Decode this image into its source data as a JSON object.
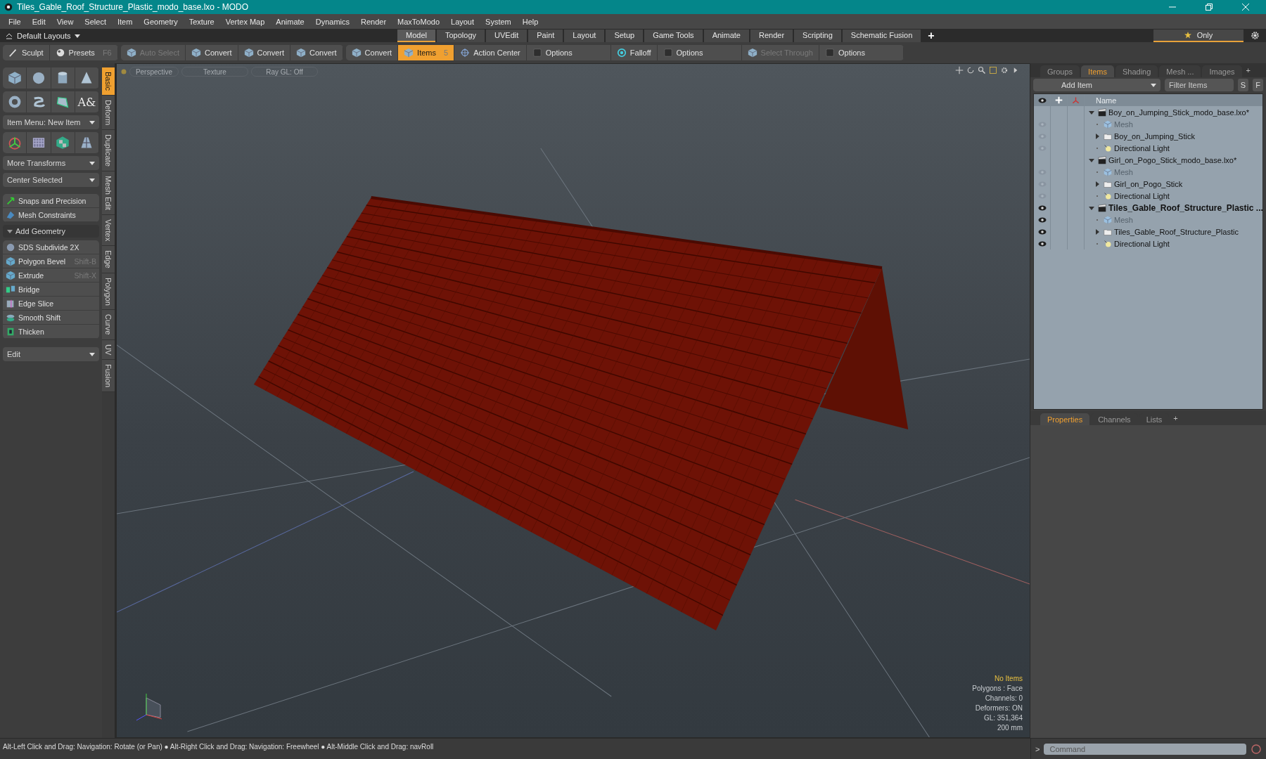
{
  "window": {
    "title": "Tiles_Gable_Roof_Structure_Plastic_modo_base.lxo - MODO"
  },
  "menu": [
    "File",
    "Edit",
    "View",
    "Select",
    "Item",
    "Geometry",
    "Texture",
    "Vertex Map",
    "Animate",
    "Dynamics",
    "Render",
    "MaxToModo",
    "Layout",
    "System",
    "Help"
  ],
  "layout_bar": {
    "layouts": "Default Layouts",
    "add": "+",
    "only": "Only",
    "tabs": [
      {
        "label": "Model",
        "selected": true
      },
      {
        "label": "Topology",
        "selected": false
      },
      {
        "label": "UVEdit",
        "selected": false
      },
      {
        "label": "Paint",
        "selected": false
      },
      {
        "label": "Layout",
        "selected": false
      },
      {
        "label": "Setup",
        "selected": false
      },
      {
        "label": "Game Tools",
        "selected": false
      },
      {
        "label": "Animate",
        "selected": false
      },
      {
        "label": "Render",
        "selected": false
      },
      {
        "label": "Scripting",
        "selected": false
      },
      {
        "label": "Schematic Fusion",
        "selected": false
      }
    ]
  },
  "toolbar": [
    [
      {
        "label": "Sculpt",
        "kind": "brush",
        "disabled": false,
        "selected": false
      },
      {
        "label": "Presets",
        "kind": "ball",
        "shortcut": "F6",
        "disabled": false,
        "selected": false
      }
    ],
    [
      {
        "label": "Auto Select",
        "kind": "cube",
        "disabled": true,
        "selected": false
      },
      {
        "label": "Convert",
        "kind": "cube",
        "disabled": false,
        "selected": false
      },
      {
        "label": "Convert",
        "kind": "cube",
        "disabled": false,
        "selected": false
      },
      {
        "label": "Convert",
        "kind": "cube",
        "disabled": false,
        "selected": false
      }
    ],
    [
      {
        "label": "Convert",
        "kind": "cube",
        "disabled": false,
        "selected": false
      },
      {
        "label": "Items",
        "kind": "cube",
        "shortcut": "5",
        "disabled": false,
        "selected": true
      },
      {
        "label": "Action Center",
        "kind": "target",
        "disabled": false,
        "selected": false
      },
      {
        "label": "Options",
        "kind": "option",
        "disabled": false,
        "selected": false
      },
      {
        "label": "Falloff",
        "kind": "ring",
        "disabled": false,
        "selected": false
      },
      {
        "label": "Options",
        "kind": "option",
        "disabled": false,
        "selected": false
      },
      {
        "label": "Select Through",
        "kind": "cube",
        "disabled": true,
        "selected": false
      },
      {
        "label": "Options",
        "kind": "option",
        "disabled": false,
        "selected": false
      }
    ]
  ],
  "left_panel": {
    "text_glyph": "A&",
    "item_menu": "Item Menu: New Item",
    "dropdowns": [
      "More Transforms",
      "Center Selected"
    ],
    "constraints": [
      {
        "label": "Snaps and Precision",
        "kind": "snap"
      },
      {
        "label": "Mesh Constraints",
        "kind": "constraint"
      }
    ],
    "section": {
      "label": "Add Geometry",
      "expanded": true
    },
    "tools": [
      {
        "label": "SDS Subdivide 2X",
        "kind": "sds"
      },
      {
        "label": "Polygon Bevel",
        "shortcut": "Shift-B",
        "kind": "cube"
      },
      {
        "label": "Extrude",
        "shortcut": "Shift-X",
        "kind": "cube"
      },
      {
        "label": "Bridge",
        "kind": "bridge"
      },
      {
        "label": "Edge Slice",
        "kind": "slice"
      },
      {
        "label": "Smooth Shift",
        "kind": "smooth"
      },
      {
        "label": "Thicken",
        "kind": "thicken"
      }
    ],
    "edit": "Edit",
    "side_tabs": [
      {
        "label": "Basic",
        "selected": true
      },
      {
        "label": "Deform",
        "selected": false
      },
      {
        "label": "Duplicate",
        "selected": false
      },
      {
        "label": "Mesh Edit",
        "selected": false
      },
      {
        "label": "Vertex",
        "selected": false
      },
      {
        "label": "Edge",
        "selected": false
      },
      {
        "label": "Polygon",
        "selected": false
      },
      {
        "label": "Curve",
        "selected": false
      },
      {
        "label": "UV",
        "selected": false
      },
      {
        "label": "Fusion",
        "selected": false
      }
    ]
  },
  "viewport": {
    "header": [
      "Perspective",
      "Texture",
      "Ray GL: Off"
    ],
    "info": [
      {
        "text": "No Items",
        "highlight": true
      },
      {
        "text": "Polygons : Face",
        "highlight": false
      },
      {
        "text": "Channels: 0",
        "highlight": false
      },
      {
        "text": "Deformers: ON",
        "highlight": false
      },
      {
        "text": "GL: 351,364",
        "highlight": false
      },
      {
        "text": "200 mm",
        "highlight": false
      }
    ]
  },
  "items_panel": {
    "tabs": [
      {
        "label": "Groups",
        "selected": false
      },
      {
        "label": "Items",
        "selected": true
      },
      {
        "label": "Shading",
        "selected": false
      },
      {
        "label": "Mesh ...",
        "selected": false
      },
      {
        "label": "Images",
        "selected": false
      }
    ],
    "add_tab": "+",
    "add_item": "Add Item",
    "filter_placeholder": "Filter Items",
    "buttons": [
      "S",
      "F"
    ],
    "column": "Name",
    "scenes": [
      {
        "name": "Boy_on_Jumping_Stick_modo_base.lxo*",
        "current": false,
        "expanded": true,
        "children": [
          {
            "name": "Mesh",
            "kind": "mesh"
          },
          {
            "name": "Boy_on_Jumping_Stick",
            "kind": "group"
          },
          {
            "name": "Directional Light",
            "kind": "light"
          }
        ]
      },
      {
        "name": "Girl_on_Pogo_Stick_modo_base.lxo*",
        "current": false,
        "expanded": true,
        "children": [
          {
            "name": "Mesh",
            "kind": "mesh"
          },
          {
            "name": "Girl_on_Pogo_Stick",
            "kind": "group"
          },
          {
            "name": "Directional Light",
            "kind": "light"
          }
        ]
      },
      {
        "name": "Tiles_Gable_Roof_Structure_Plastic ...",
        "current": true,
        "expanded": true,
        "children": [
          {
            "name": "Mesh",
            "kind": "mesh"
          },
          {
            "name": "Tiles_Gable_Roof_Structure_Plastic",
            "kind": "group"
          },
          {
            "name": "Directional Light",
            "kind": "light"
          }
        ]
      }
    ]
  },
  "properties_panel": {
    "tabs": [
      {
        "label": "Properties",
        "selected": true
      },
      {
        "label": "Channels",
        "selected": false
      },
      {
        "label": "Lists",
        "selected": false
      }
    ],
    "add_tab": "+"
  },
  "status_bar": {
    "hint": "Alt-Left Click and Drag: Navigation: Rotate (or Pan) ● Alt-Right Click and Drag: Navigation: Freewheel ● Alt-Middle Click and Drag: navRoll",
    "prompt": ">",
    "command_placeholder": "Command"
  }
}
